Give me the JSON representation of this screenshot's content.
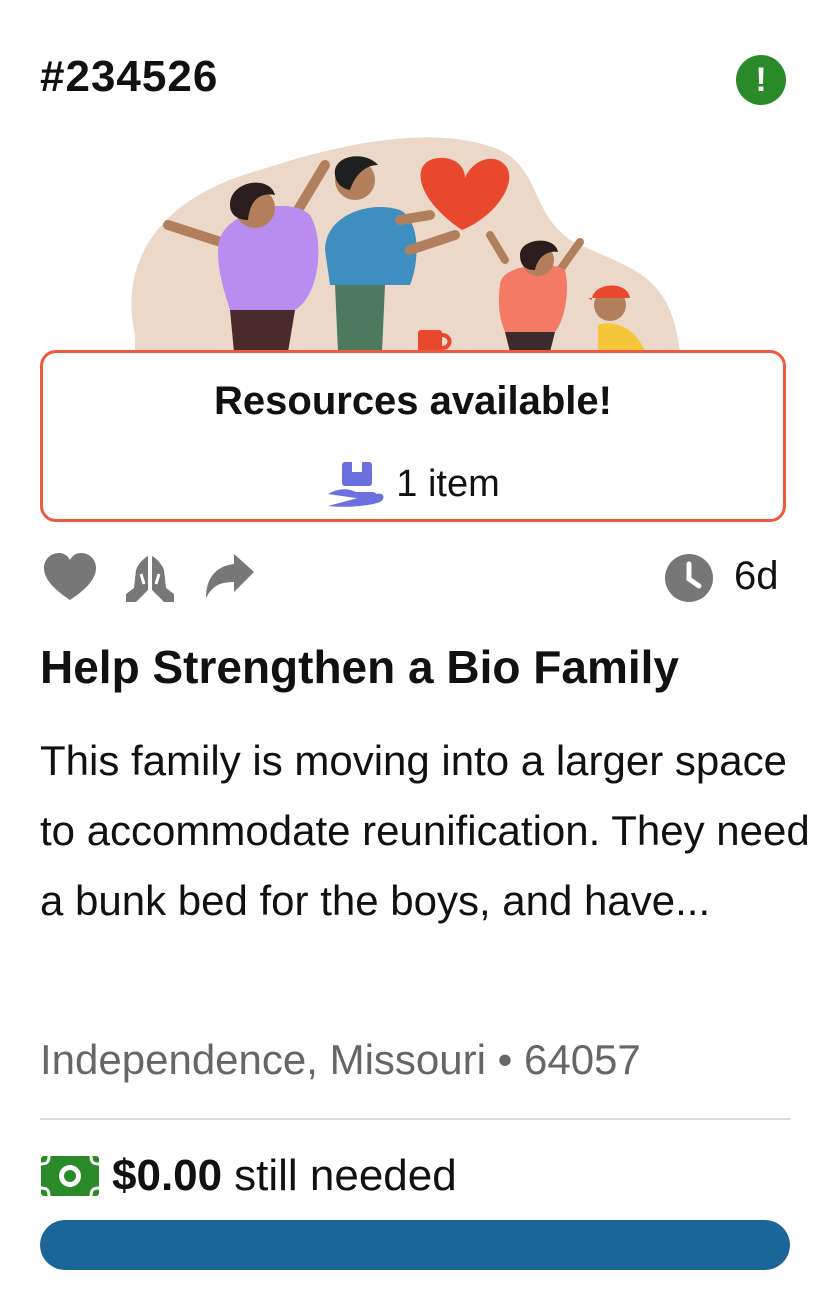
{
  "case": {
    "id": "#234526",
    "alert_symbol": "!"
  },
  "illustration": {
    "name": "family-celebrating-illustration"
  },
  "resources": {
    "title": "Resources available!",
    "items_label": "1 item",
    "icon": "box-hand-icon"
  },
  "actions": {
    "like_icon": "heart-icon",
    "pray_icon": "praying-hands-icon",
    "share_icon": "share-arrow-icon",
    "time_icon": "clock-icon",
    "time_label": "6d"
  },
  "need": {
    "title": "Help Strengthen a Bio Family",
    "description": "This family is moving into a larger space to accommodate reunification. They need a bunk bed for the boys, and have...",
    "location": "Independence, Missouri • 64057"
  },
  "funding": {
    "amount": "$0.00",
    "label": "still needed",
    "progress": 1.0,
    "icon": "money-icon"
  },
  "colors": {
    "accent": "#ef5a3c",
    "alert_green": "#2a8a2a",
    "progress_blue": "#1b6699",
    "icon_purple": "#6c6fe0",
    "icon_gray": "#777777"
  }
}
